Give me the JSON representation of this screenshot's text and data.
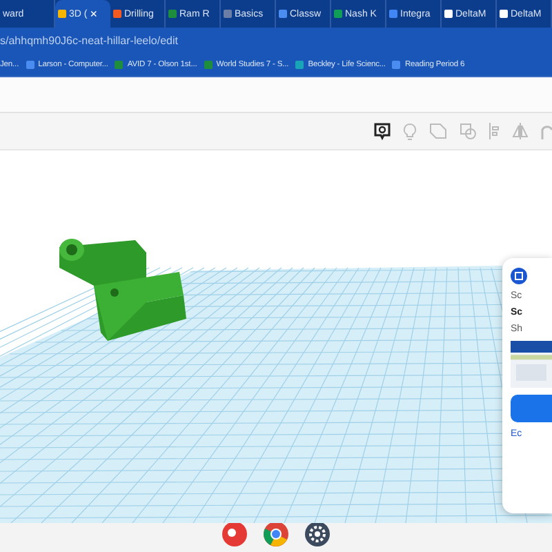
{
  "tabs": [
    {
      "label": "ward",
      "selected": false,
      "kind": "plain"
    },
    {
      "label": "3D (",
      "selected": true,
      "kind": "grid",
      "close": "×"
    },
    {
      "label": "Drilling",
      "selected": false,
      "kind": "orange"
    },
    {
      "label": "Ram R",
      "selected": false,
      "kind": "classroom"
    },
    {
      "label": "Basics",
      "selected": false,
      "kind": "globe"
    },
    {
      "label": "Classw",
      "selected": false,
      "kind": "blue"
    },
    {
      "label": "Nash K",
      "selected": false,
      "kind": "sheet"
    },
    {
      "label": "Integra",
      "selected": false,
      "kind": "doc"
    },
    {
      "label": "DeltaM",
      "selected": false,
      "kind": "white"
    },
    {
      "label": "DeltaM",
      "selected": false,
      "kind": "white"
    }
  ],
  "address": "s/ahhqmh90J6c-neat-hillar-leelo/edit",
  "bookmarks": [
    {
      "label": "Jen...",
      "kind": "plain"
    },
    {
      "label": "Larson - Computer...",
      "kind": "blue"
    },
    {
      "label": "AVID 7 - Olson 1st...",
      "kind": "green"
    },
    {
      "label": "World Studies 7 - S...",
      "kind": "green"
    },
    {
      "label": "Beckley - Life Scienc...",
      "kind": "teal"
    },
    {
      "label": "Reading Period 6",
      "kind": "blue"
    }
  ],
  "notification": {
    "app": "Sc",
    "title": "Sc",
    "body": "Sh",
    "link": "Ec"
  }
}
